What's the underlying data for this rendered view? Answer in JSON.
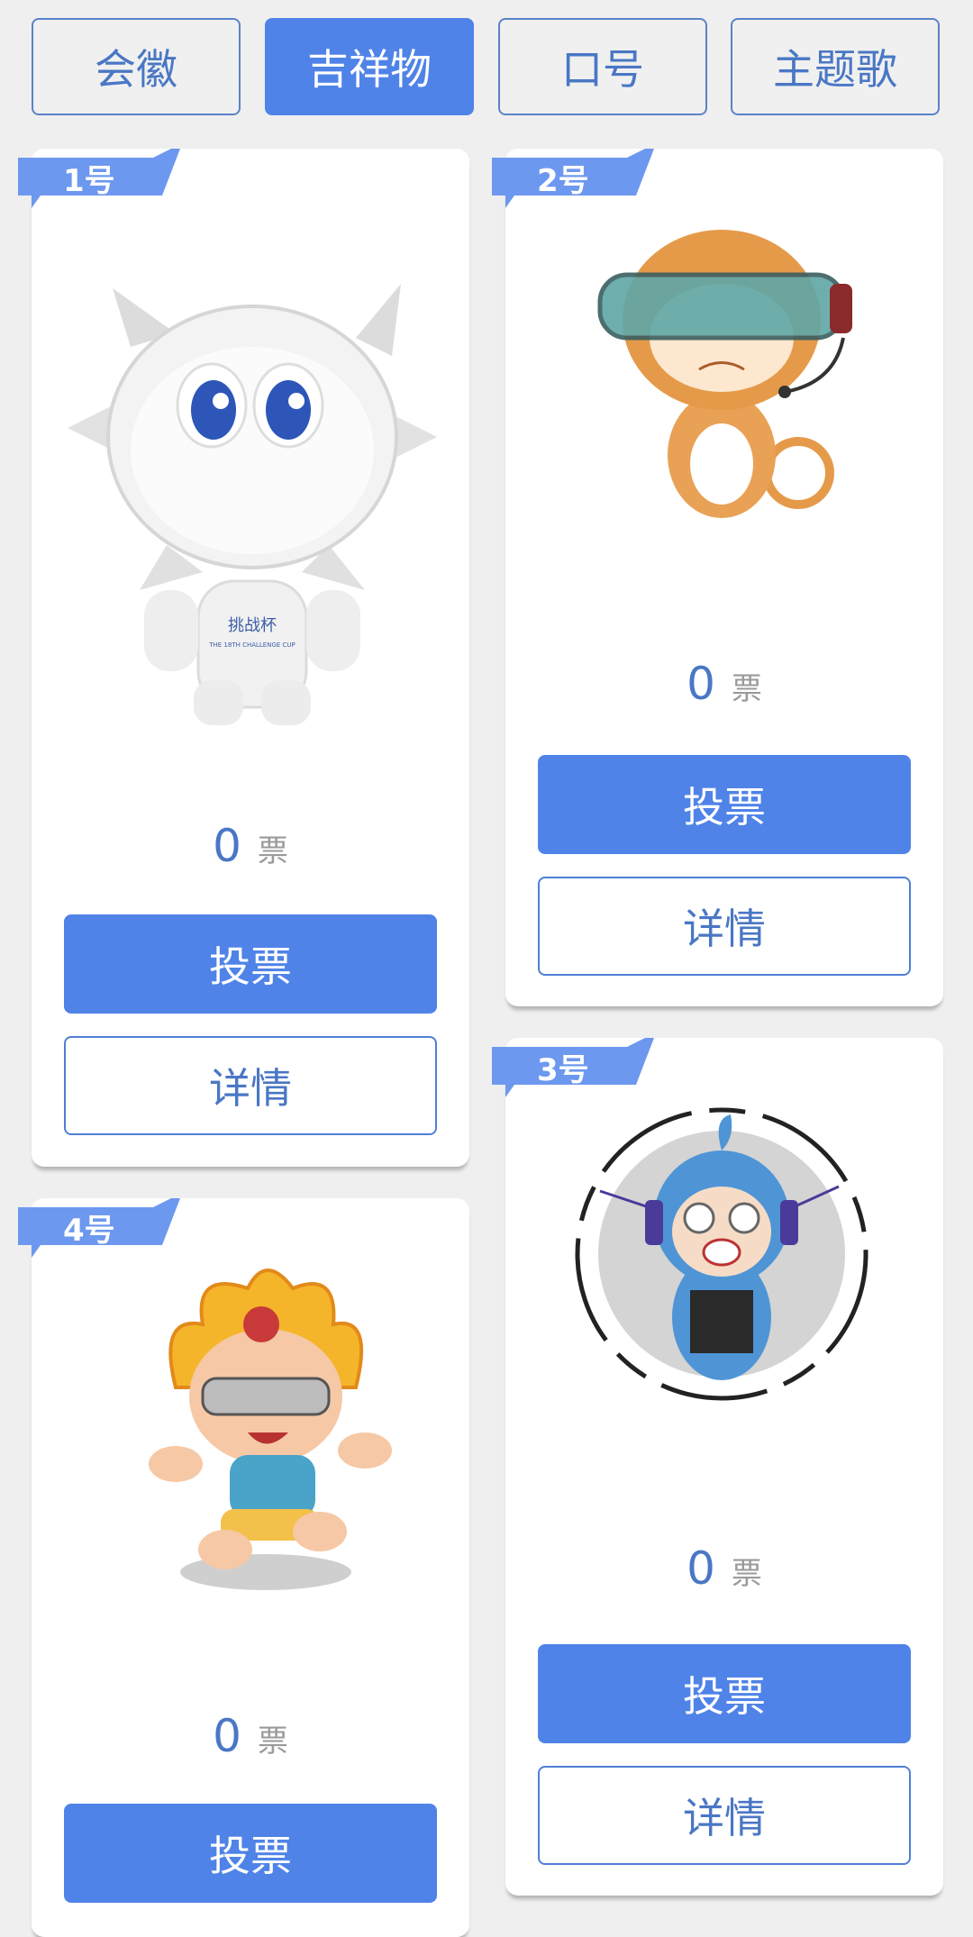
{
  "tabs": [
    {
      "label": "会徽"
    },
    {
      "label": "吉祥物"
    },
    {
      "label": "口号"
    },
    {
      "label": "主题歌"
    }
  ],
  "cards": [
    {
      "badge": "1号",
      "votes": "0",
      "vote_unit": "票",
      "vote_label": "投票",
      "detail_label": "详情"
    },
    {
      "badge": "2号",
      "votes": "0",
      "vote_unit": "票",
      "vote_label": "投票",
      "detail_label": "详情"
    },
    {
      "badge": "3号",
      "votes": "0",
      "vote_unit": "票",
      "vote_label": "投票",
      "detail_label": "详情"
    },
    {
      "badge": "4号",
      "votes": "0",
      "vote_unit": "票",
      "vote_label": "投票"
    }
  ],
  "mascot_print": {
    "line1": "挑战杯",
    "line2": "THE 18TH CHALLENGE CUP"
  },
  "colors": {
    "primary": "#4f83e8",
    "text_blue": "#4a77c5",
    "background": "#efefef"
  }
}
